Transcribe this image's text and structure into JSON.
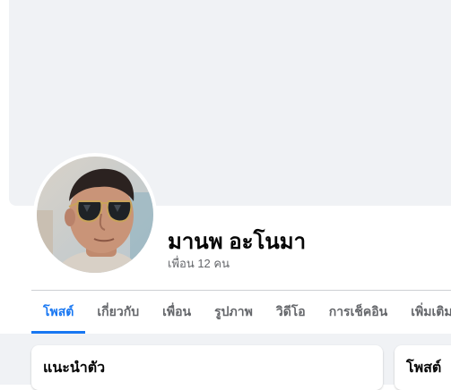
{
  "profile": {
    "name": "มานพ อะโนมา",
    "friends_count": "เพื่อน 12 คน"
  },
  "tabs": [
    {
      "label": "โพสต์",
      "active": true
    },
    {
      "label": "เกี่ยวกับ",
      "active": false
    },
    {
      "label": "เพื่อน",
      "active": false
    },
    {
      "label": "รูปภาพ",
      "active": false
    },
    {
      "label": "วิดีโอ",
      "active": false
    },
    {
      "label": "การเช็คอิน",
      "active": false
    },
    {
      "label": "เพิ่มเติม",
      "active": false,
      "dropdown": true
    }
  ],
  "cards": {
    "intro_title": "แนะนำตัว",
    "posts_title": "โพสต์"
  },
  "colors": {
    "accent": "#1877f2",
    "cover": "#f0f2f5",
    "secondary_text": "#65676b"
  },
  "icons": {
    "more_tab": "caret-down-icon"
  }
}
